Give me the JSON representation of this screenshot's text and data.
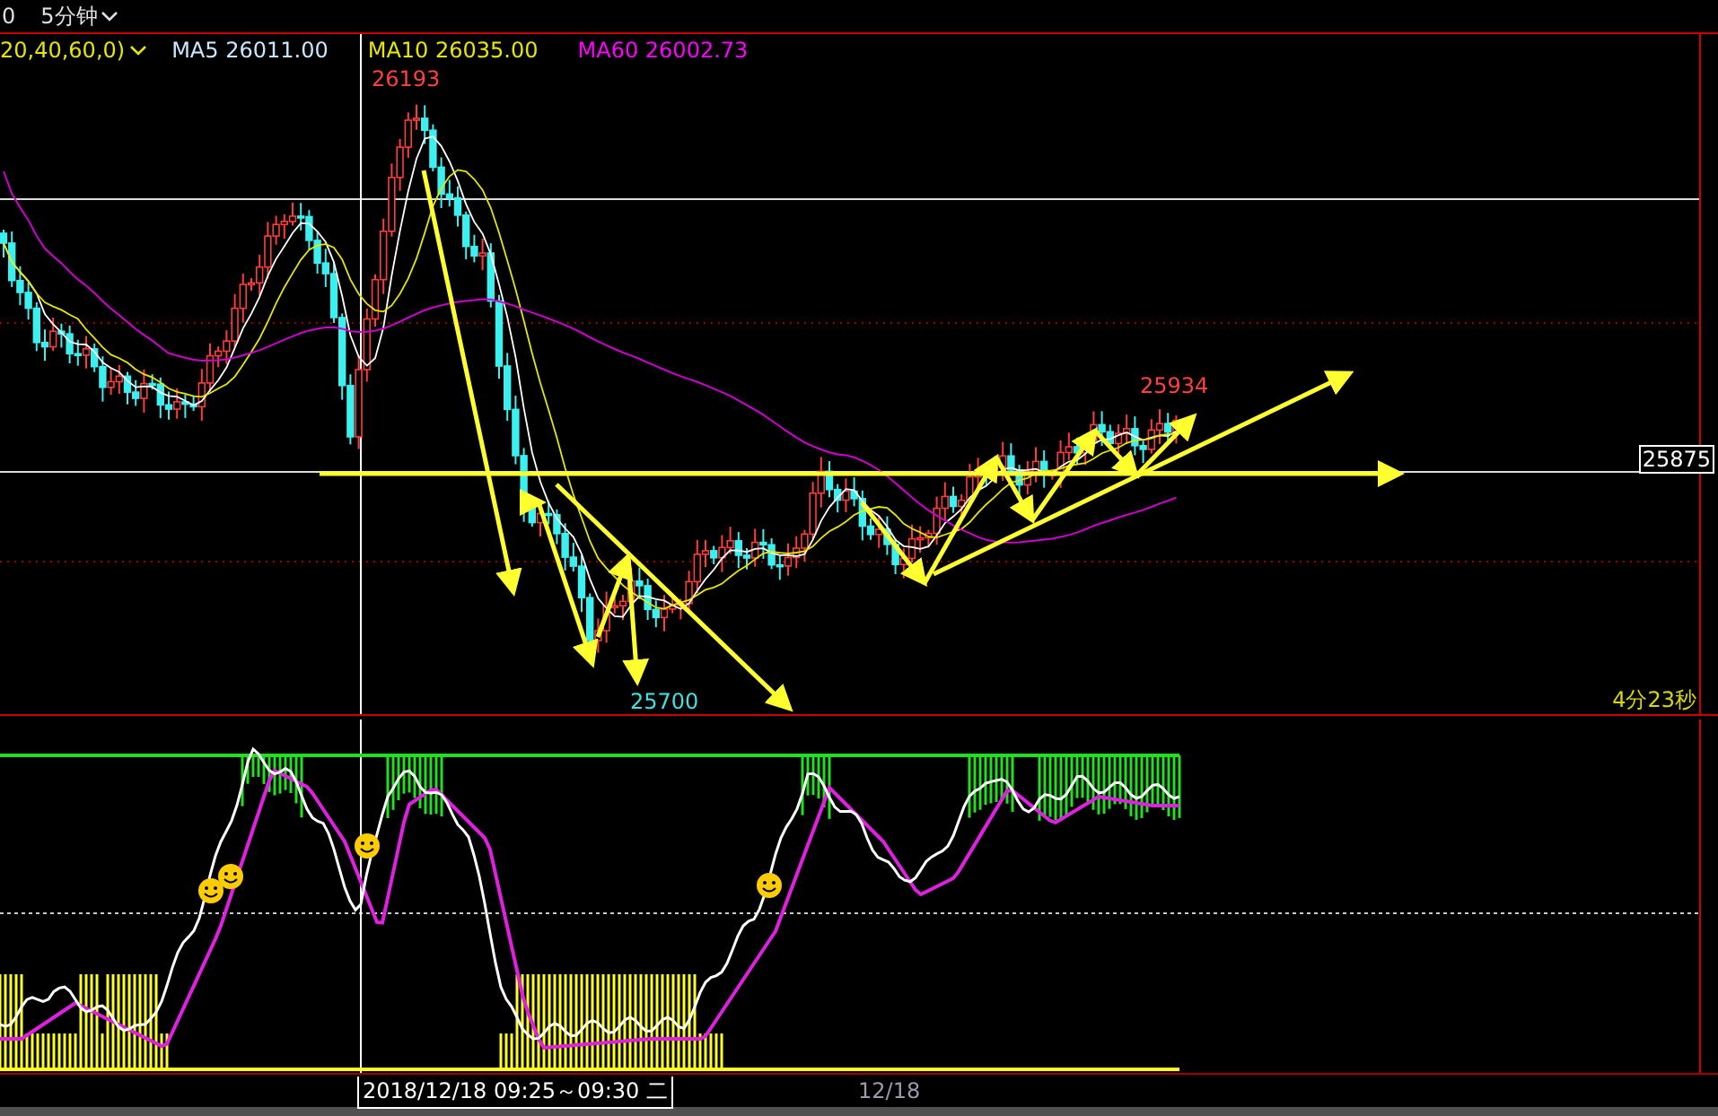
{
  "top_bar": {
    "cut_label": "0",
    "period": "5分钟"
  },
  "legend": {
    "params": "20,40,60,0)",
    "averages": [
      {
        "label": "MA5 26011.00",
        "color": "#c8e6ff"
      },
      {
        "label": "MA10 26035.00",
        "color": "#e6e600"
      },
      {
        "label": "MA60 26002.73",
        "color": "#ff00ff"
      }
    ]
  },
  "main_chart": {
    "high_label": "26193",
    "low_label": "25700",
    "recent_high_label": "25934",
    "price_tag": "25875",
    "countdown": "4分23秒"
  },
  "x_axis": {
    "cursor_time": "2018/12/18 09:25～09:30 二",
    "date_label": "12/18"
  }
}
